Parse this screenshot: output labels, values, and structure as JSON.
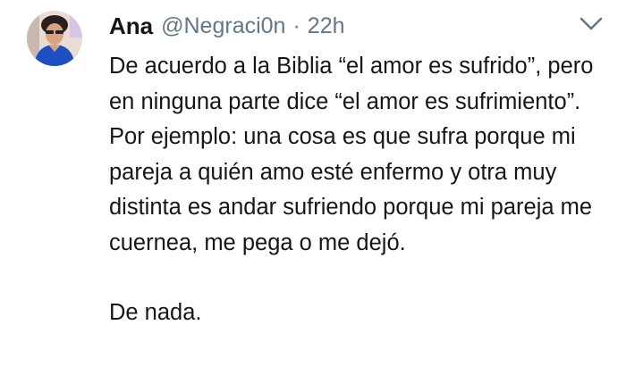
{
  "tweet": {
    "author": {
      "name": "Ana",
      "handle": "@Negraci0n"
    },
    "separator": "·",
    "timestamp": "22h",
    "text_main": "De acuerdo a la Biblia “el amor es sufrido”, pero en ninguna parte dice “el amor es sufrimiento”. Por ejemplo: una cosa es que sufra porque mi pareja a quién amo esté enfermo y otra muy distinta es andar sufriendo porque mi pareja me cuernea, me pega o me dejó.",
    "text_closing": "De nada.",
    "menu_icon": "chevron-down-icon",
    "colors": {
      "text": "#14171a",
      "secondary": "#657786",
      "avatar_bg": "#e9dcd3",
      "avatar_top": "#1e4fbf"
    }
  }
}
